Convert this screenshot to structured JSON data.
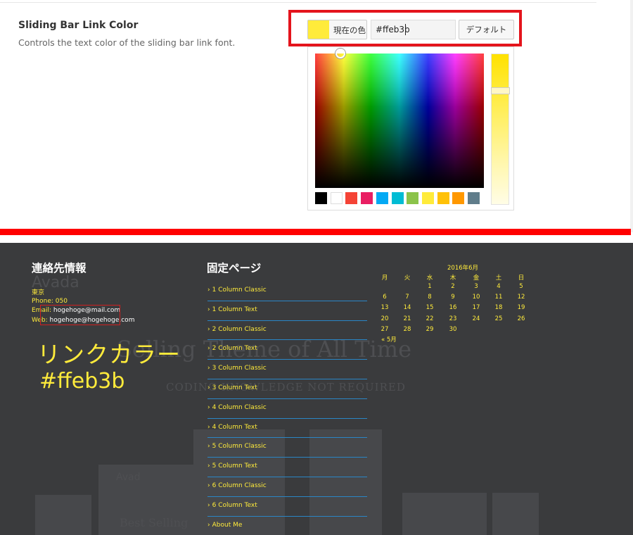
{
  "settings": {
    "title": "Sliding Bar Link Color",
    "description": "Controls the text color of the sliding bar link font.",
    "current_color_label": "現在の色",
    "hex_value": "#ffeb3b",
    "default_label": "デフォルト",
    "current_color": "#ffeb3b",
    "palette": [
      "#000000",
      "#ffffff",
      "#f44336",
      "#e91e63",
      "#03a9f4",
      "#00bcd4",
      "#8bc34a",
      "#ffeb3b",
      "#ffc107",
      "#ff9800",
      "#607d8b"
    ]
  },
  "footer": {
    "contact": {
      "title": "連絡先情報",
      "city": "東京",
      "phone": "Phone: 050",
      "email_label": "Email:",
      "email": "hogehoge@mail.com",
      "web_label": "Web:",
      "web": "hogehoge@hogehoge.com"
    },
    "pages": {
      "title": "固定ページ",
      "items": [
        "1 Column Classic",
        "1 Column Text",
        "2 Column Classic",
        "2 Column Text",
        "3 Column Classic",
        "3 Column Text",
        "4 Column Classic",
        "4 Column Text",
        "5 Column Classic",
        "5 Column Text",
        "6 Column Classic",
        "6 Column Text",
        "About Me"
      ]
    },
    "calendar": {
      "caption": "2016年6月",
      "weekdays": [
        "月",
        "火",
        "水",
        "木",
        "金",
        "土",
        "日"
      ],
      "rows": [
        [
          "",
          "",
          "1",
          "2",
          "3",
          "4",
          "5"
        ],
        [
          "6",
          "7",
          "8",
          "9",
          "10",
          "11",
          "12"
        ],
        [
          "13",
          "14",
          "15",
          "16",
          "17",
          "18",
          "19"
        ],
        [
          "20",
          "21",
          "22",
          "23",
          "24",
          "25",
          "26"
        ],
        [
          "27",
          "28",
          "29",
          "30",
          "",
          "",
          ""
        ]
      ],
      "prev": "« 5月"
    },
    "annotation": {
      "line1": "リンクカラー",
      "line2": "#ffeb3b"
    },
    "ghost": {
      "logo": "Avada",
      "headline": "Selling Theme of All Time",
      "subline": "CODING KNOWLEDGE NOT REQUIRED",
      "small_logo": "Avad",
      "small_head": "Best Selling"
    },
    "link_color": "#ffeb3b",
    "divider_color": "#2a86c6"
  }
}
